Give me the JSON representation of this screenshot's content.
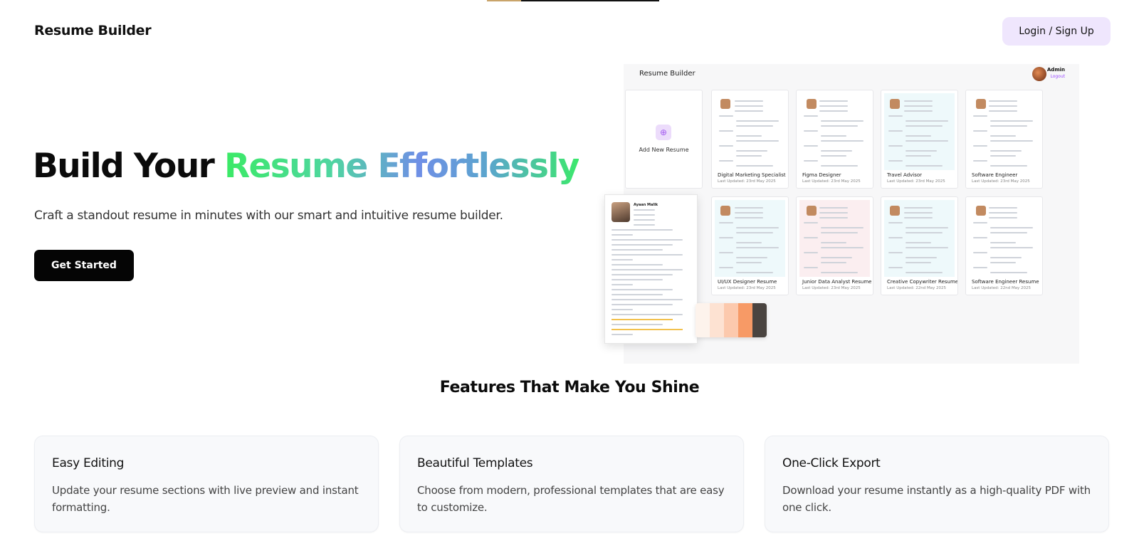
{
  "nav": {
    "brand": "Resume Builder",
    "login_label": "Login / Sign Up"
  },
  "hero": {
    "title_plain": "Build Your",
    "title_highlight": "Resume Effortlessly",
    "subtitle": "Craft a standout resume in minutes with our smart and intuitive resume builder.",
    "cta_label": "Get Started",
    "gradient_colors": [
      "#3bea66",
      "#4fd6a0",
      "#6f8fe6",
      "#5aa6cc",
      "#3ce86c"
    ]
  },
  "preview": {
    "brand": "Resume Builder",
    "user_name": "Admin",
    "logout_label": "Logout",
    "add_label": "Add New Resume",
    "resumes": [
      {
        "title": "Digital Marketing Specialist",
        "date": "Last Updated: 23rd May 2025",
        "tint": "white"
      },
      {
        "title": "Figma Designer",
        "date": "Last Updated: 23rd May 2025",
        "tint": "white"
      },
      {
        "title": "Travel Advisor",
        "date": "Last Updated: 23rd May 2025",
        "tint": "blue"
      },
      {
        "title": "Software Engineer",
        "date": "Last Updated: 23rd May 2025",
        "tint": "white"
      },
      {
        "title": "UI/UX Designer Resume",
        "date": "Last Updated: 23rd May 2025",
        "tint": "blue"
      },
      {
        "title": "Junior Data Analyst Resume",
        "date": "Last Updated: 23rd May 2025",
        "tint": "pink"
      },
      {
        "title": "Creative Copywriter Resume",
        "date": "Last Updated: 22nd May 2025",
        "tint": "blue"
      },
      {
        "title": "Software Engineer Resume",
        "date": "Last Updated: 22nd May 2025",
        "tint": "white"
      }
    ],
    "floating_resume_name": "Ayaan Malik",
    "palette": [
      "#fdf3ec",
      "#fde2d2",
      "#fcc9ad",
      "#f79a66",
      "#4a4440"
    ]
  },
  "features": {
    "title": "Features That Make You Shine",
    "items": [
      {
        "title": "Easy Editing",
        "desc": "Update your resume sections with live preview and instant formatting."
      },
      {
        "title": "Beautiful Templates",
        "desc": "Choose from modern, professional templates that are easy to customize."
      },
      {
        "title": "One-Click Export",
        "desc": "Download your resume instantly as a high-quality PDF with one click."
      }
    ]
  }
}
